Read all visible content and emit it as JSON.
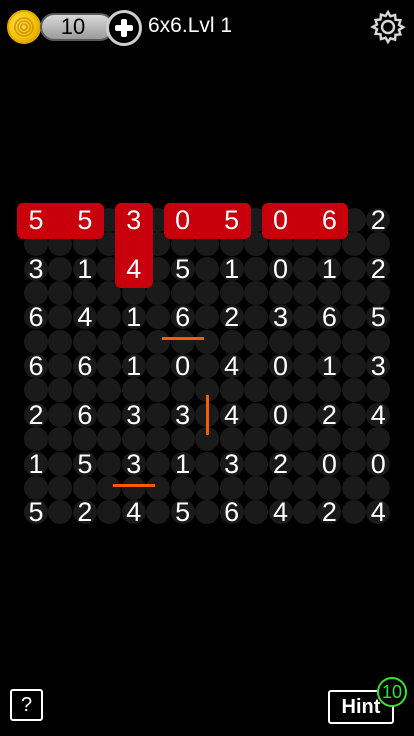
{
  "header": {
    "coin_count": "10",
    "level_label": "6x6.Lvl 1"
  },
  "board": {
    "rows": [
      [
        "5",
        "5",
        "3",
        "0",
        "5",
        "0",
        "6",
        "2"
      ],
      [
        "3",
        "1",
        "4",
        "5",
        "1",
        "0",
        "1",
        "2"
      ],
      [
        "6",
        "4",
        "1",
        "6",
        "2",
        "3",
        "6",
        "5"
      ],
      [
        "6",
        "6",
        "1",
        "0",
        "4",
        "0",
        "1",
        "3"
      ],
      [
        "2",
        "6",
        "3",
        "3",
        "4",
        "0",
        "2",
        "4"
      ],
      [
        "1",
        "5",
        "3",
        "1",
        "3",
        "2",
        "0",
        "0"
      ],
      [
        "5",
        "2",
        "4",
        "5",
        "6",
        "4",
        "2",
        "4"
      ]
    ],
    "highlight_color": "#c8000b",
    "wall_color": "#ff5a00"
  },
  "footer": {
    "help_label": "?",
    "hint_label": "Hint",
    "hint_count": "10"
  }
}
